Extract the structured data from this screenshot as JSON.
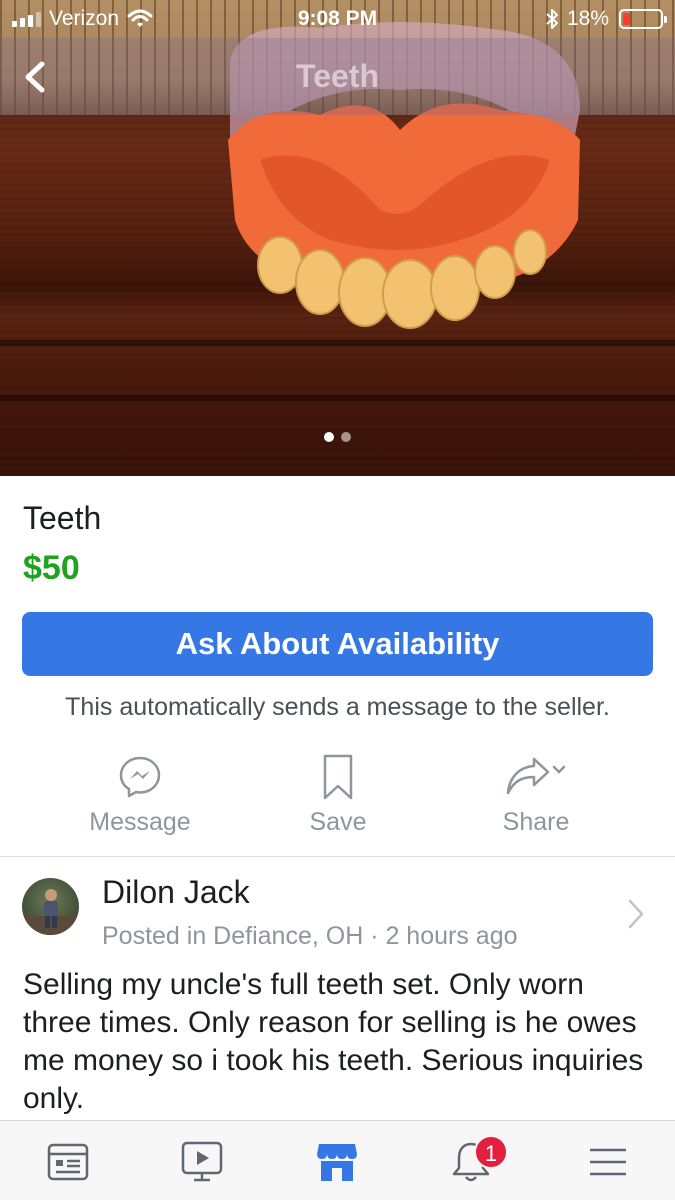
{
  "status_bar": {
    "carrier": "Verizon",
    "time": "9:08 PM",
    "battery": "18%",
    "battery_level": 0.18
  },
  "nav": {
    "title": "Teeth"
  },
  "gallery": {
    "photo_count": 2,
    "active_index": 0
  },
  "listing": {
    "title": "Teeth",
    "price": "$50",
    "ask_button": "Ask About Availability",
    "auto_note": "This automatically sends a message to the seller."
  },
  "actions": {
    "message": "Message",
    "save": "Save",
    "share": "Share"
  },
  "seller": {
    "name": "Dilon Jack",
    "meta": "Posted in Defiance, OH · 2 hours ago",
    "description": "Selling my uncle's full teeth set. Only worn three times. Only reason for selling is he owes me money so i took his teeth. Serious inquiries only."
  },
  "tabbar": {
    "notifications_badge": "1"
  },
  "colors": {
    "accent": "#3578e5",
    "price": "#1fa21f",
    "badge": "#e41e3f",
    "muted": "#90949c"
  }
}
